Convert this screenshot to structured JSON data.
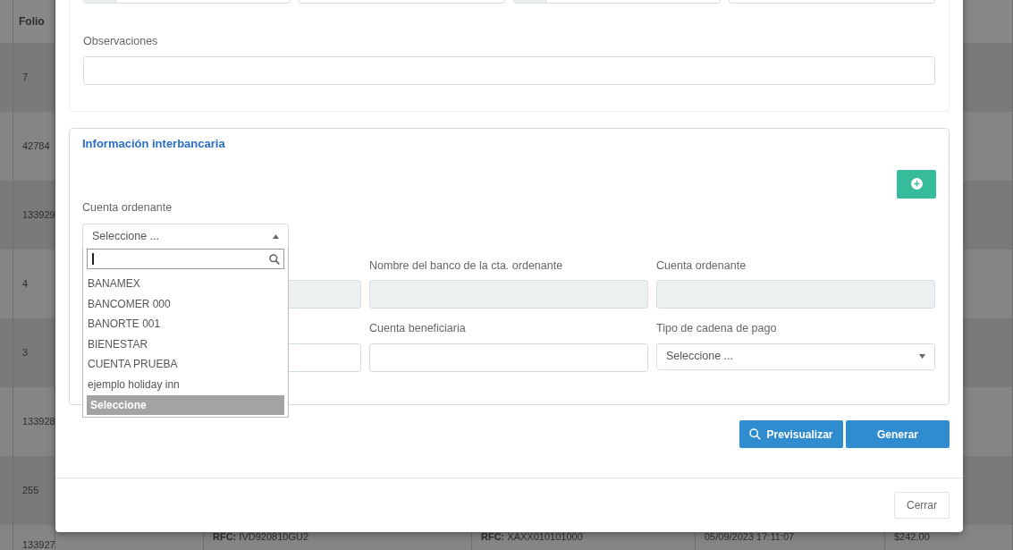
{
  "background_table": {
    "header": "Folio",
    "rows": [
      {
        "folio": "7"
      },
      {
        "folio": "42784"
      },
      {
        "folio": "133929"
      },
      {
        "folio": "4"
      },
      {
        "folio": "3"
      },
      {
        "folio": "133928"
      },
      {
        "folio": "255"
      },
      {
        "folio": "133927",
        "cells": [
          "**RFC:** IVD920810GU2",
          "**RFC:** XAXX010101000",
          "05/09/2023 17:11:07",
          "$242.00"
        ]
      }
    ]
  },
  "modal": {
    "top_fields": [
      {
        "addon": true
      },
      {
        "addon": false
      },
      {
        "addon": true
      },
      {
        "addon": false
      }
    ],
    "observaciones": {
      "label": "Observaciones"
    },
    "interbank": {
      "title": "Información interbancaria",
      "cuenta_ordenante": {
        "label": "Cuenta ordenante",
        "value": "Seleccione ...",
        "expanded": true,
        "options": [
          {
            "label": "BANAMEX",
            "selected": false
          },
          {
            "label": "BANCOMER 000",
            "selected": false
          },
          {
            "label": "BANORTE 001",
            "selected": false
          },
          {
            "label": "BIENESTAR",
            "selected": false
          },
          {
            "label": "CUENTA PRUEBA",
            "selected": false
          },
          {
            "label": "ejemplo holiday inn",
            "selected": false
          },
          {
            "label": "Seleccione",
            "selected": true
          }
        ]
      },
      "field_rows": [
        [
          {
            "kind": "input",
            "disabled": true
          },
          {
            "kind": "input",
            "label": "Nombre del banco de la cta. ordenante",
            "disabled": true
          },
          {
            "kind": "input",
            "label": "Cuenta ordenante",
            "disabled": true
          }
        ],
        [
          {
            "kind": "input",
            "disabled": false
          },
          {
            "kind": "input",
            "label": "Cuenta beneficiaria",
            "disabled": false
          },
          {
            "kind": "select",
            "label": "Tipo de cadena de pago",
            "value": "Seleccione ..."
          }
        ]
      ]
    },
    "actions": [
      {
        "label": "Previsualizar",
        "kind": "search"
      },
      {
        "label": "Generar",
        "kind": "plain"
      }
    ],
    "footer": {
      "close": "Cerrar"
    }
  }
}
